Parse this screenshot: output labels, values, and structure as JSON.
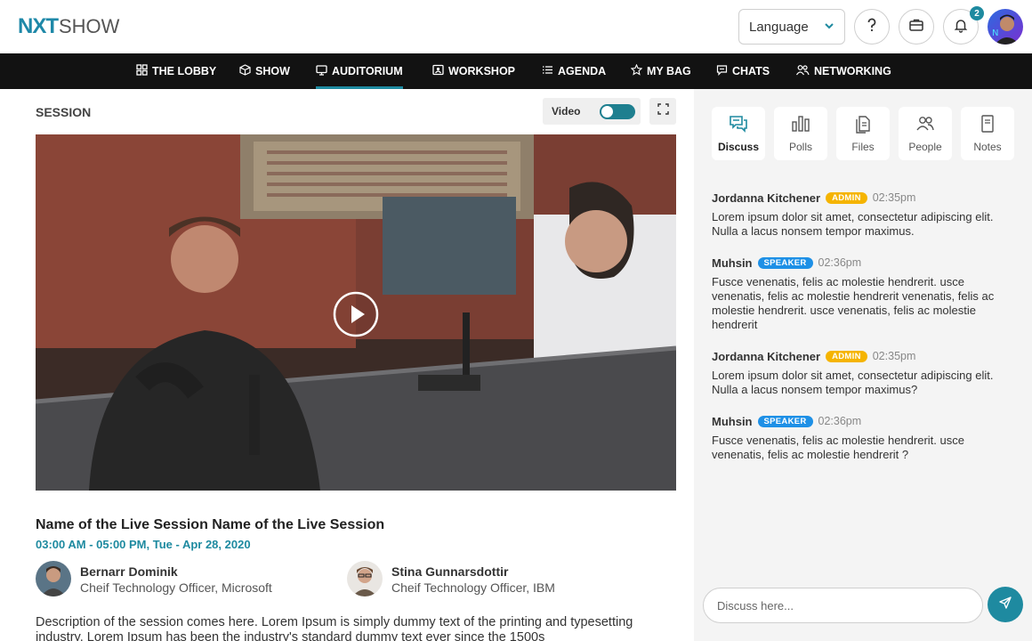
{
  "brand": {
    "logo_part1": "NXT",
    "logo_part2": "SHOW"
  },
  "header": {
    "language_label": "Language",
    "notification_count": "2",
    "accent_color": "#1e8aa0"
  },
  "nav": {
    "items": [
      {
        "label": "THE LOBBY",
        "icon": "grid-icon"
      },
      {
        "label": "SHOW",
        "icon": "cube-icon"
      },
      {
        "label": "AUDITORIUM",
        "icon": "monitor-icon",
        "active": true
      },
      {
        "label": "WORKSHOP",
        "icon": "presenter-icon"
      },
      {
        "label": "AGENDA",
        "icon": "list-icon"
      },
      {
        "label": "MY BAG",
        "icon": "star-icon"
      },
      {
        "label": "CHATS",
        "icon": "chat-icon"
      },
      {
        "label": "NETWORKING",
        "icon": "people-icon"
      }
    ]
  },
  "session": {
    "section_label": "SESSION",
    "video_toggle_label": "Video",
    "title": "Name of the Live Session Name of the Live Session",
    "time": "03:00 AM - 05:00 PM, Tue - Apr 28, 2020",
    "speakers": [
      {
        "name": "Bernarr Dominik",
        "role": "Cheif Technology Officer, Microsoft"
      },
      {
        "name": "Stina Gunnarsdottir",
        "role": "Cheif Technology Officer, IBM"
      }
    ],
    "description": "Description of the session comes here. Lorem Ipsum is simply dummy text of the printing and typesetting industry. Lorem Ipsum has been the industry's standard dummy text ever since the 1500s"
  },
  "panel": {
    "tabs": [
      {
        "label": "Discuss",
        "icon": "discuss-icon",
        "active": true
      },
      {
        "label": "Polls",
        "icon": "polls-icon"
      },
      {
        "label": "Files",
        "icon": "files-icon"
      },
      {
        "label": "People",
        "icon": "people-icon"
      },
      {
        "label": "Notes",
        "icon": "notes-icon"
      }
    ],
    "messages": [
      {
        "author": "Jordanna Kitchener",
        "role": "ADMIN",
        "time": "02:35pm",
        "text": "Lorem ipsum dolor sit amet, consectetur adipiscing elit. Nulla a lacus nonsem tempor maximus."
      },
      {
        "author": "Muhsin",
        "role": "SPEAKER",
        "time": "02:36pm",
        "text": "Fusce venenatis, felis ac molestie hendrerit.  usce venenatis, felis ac molestie hendrerit venenatis, felis ac molestie hendrerit.  usce venenatis, felis ac molestie hendrerit"
      },
      {
        "author": "Jordanna Kitchener",
        "role": "ADMIN",
        "time": "02:35pm",
        "text": "Lorem ipsum dolor sit amet, consectetur adipiscing elit. Nulla a lacus nonsem tempor maximus?"
      },
      {
        "author": "Muhsin",
        "role": "SPEAKER",
        "time": "02:36pm",
        "text": "Fusce venenatis, felis ac molestie hendrerit.  usce venenatis, felis ac molestie hendrerit ?"
      }
    ],
    "input_placeholder": "Discuss here..."
  }
}
